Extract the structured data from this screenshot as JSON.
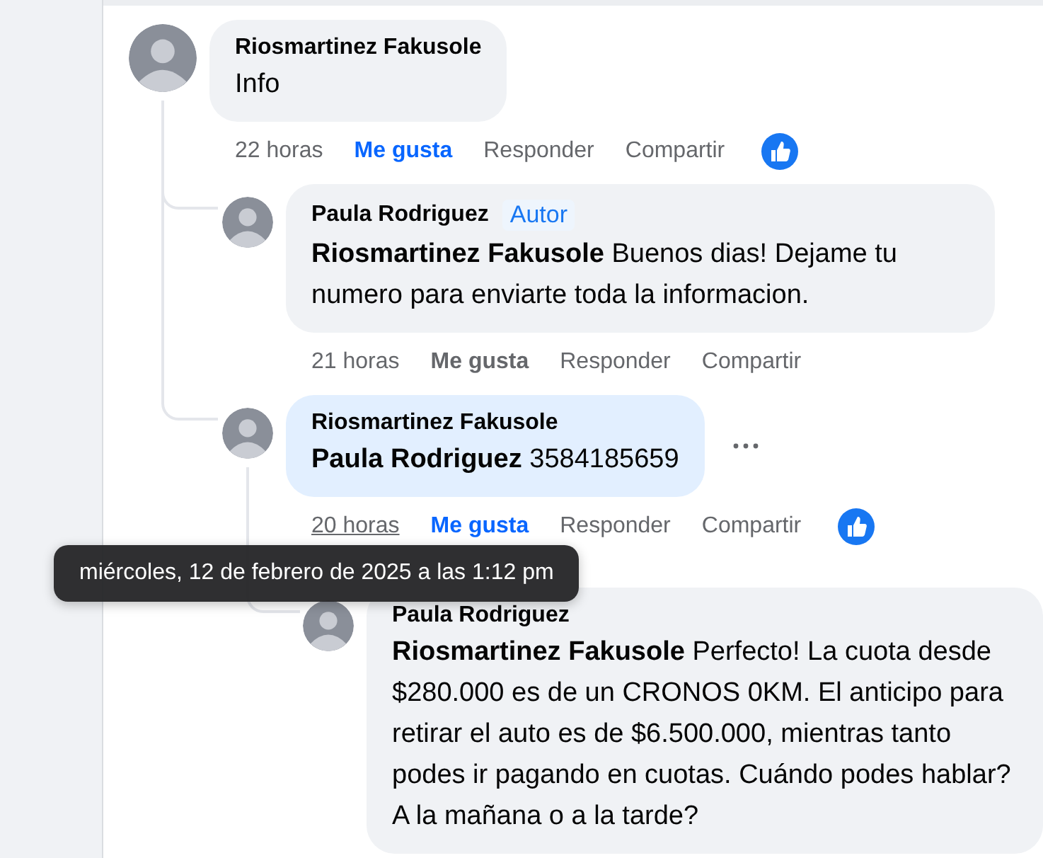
{
  "comments": [
    {
      "author": "Riosmartinez Fakusole",
      "text": "Info",
      "highlighted": false,
      "menu_shown": false,
      "reaction_shown": true,
      "actions": {
        "time": "22 horas",
        "time_hovered": false,
        "like": "Me gusta",
        "liked": true,
        "reply": "Responder",
        "share": "Compartir"
      },
      "children": [
        {
          "author": "Paula Rodriguez",
          "badge": "Autor",
          "mention": "Riosmartinez Fakusole",
          "text": "Buenos dias! Dejame tu numero para enviarte toda la informacion.",
          "highlighted": false,
          "menu_shown": false,
          "reaction_shown": false,
          "actions": {
            "time": "21 horas",
            "time_hovered": false,
            "like": "Me gusta",
            "liked": false,
            "reply": "Responder",
            "share": "Compartir"
          }
        },
        {
          "author": "Riosmartinez Fakusole",
          "mention": "Paula Rodriguez",
          "text": "3584185659",
          "highlighted": true,
          "menu_shown": true,
          "reaction_shown": true,
          "actions": {
            "time": "20 horas",
            "time_hovered": true,
            "like": "Me gusta",
            "liked": true,
            "reply": "Responder",
            "share": "Compartir"
          },
          "children": [
            {
              "author": "Paula Rodriguez",
              "mention": "Riosmartinez Fakusole",
              "text": "Perfecto! La cuota desde $280.000 es de un CRONOS 0KM. El anticipo para retirar el auto es de $6.500.000, mientras tanto podes ir pagando en cuotas. Cuándo podes hablar? A la mañana o a la tarde?",
              "highlighted": false,
              "menu_shown": false,
              "reaction_shown": false
            }
          ]
        }
      ]
    }
  ],
  "tooltip": "miércoles, 12 de febrero de 2025 a las 1:12 pm"
}
